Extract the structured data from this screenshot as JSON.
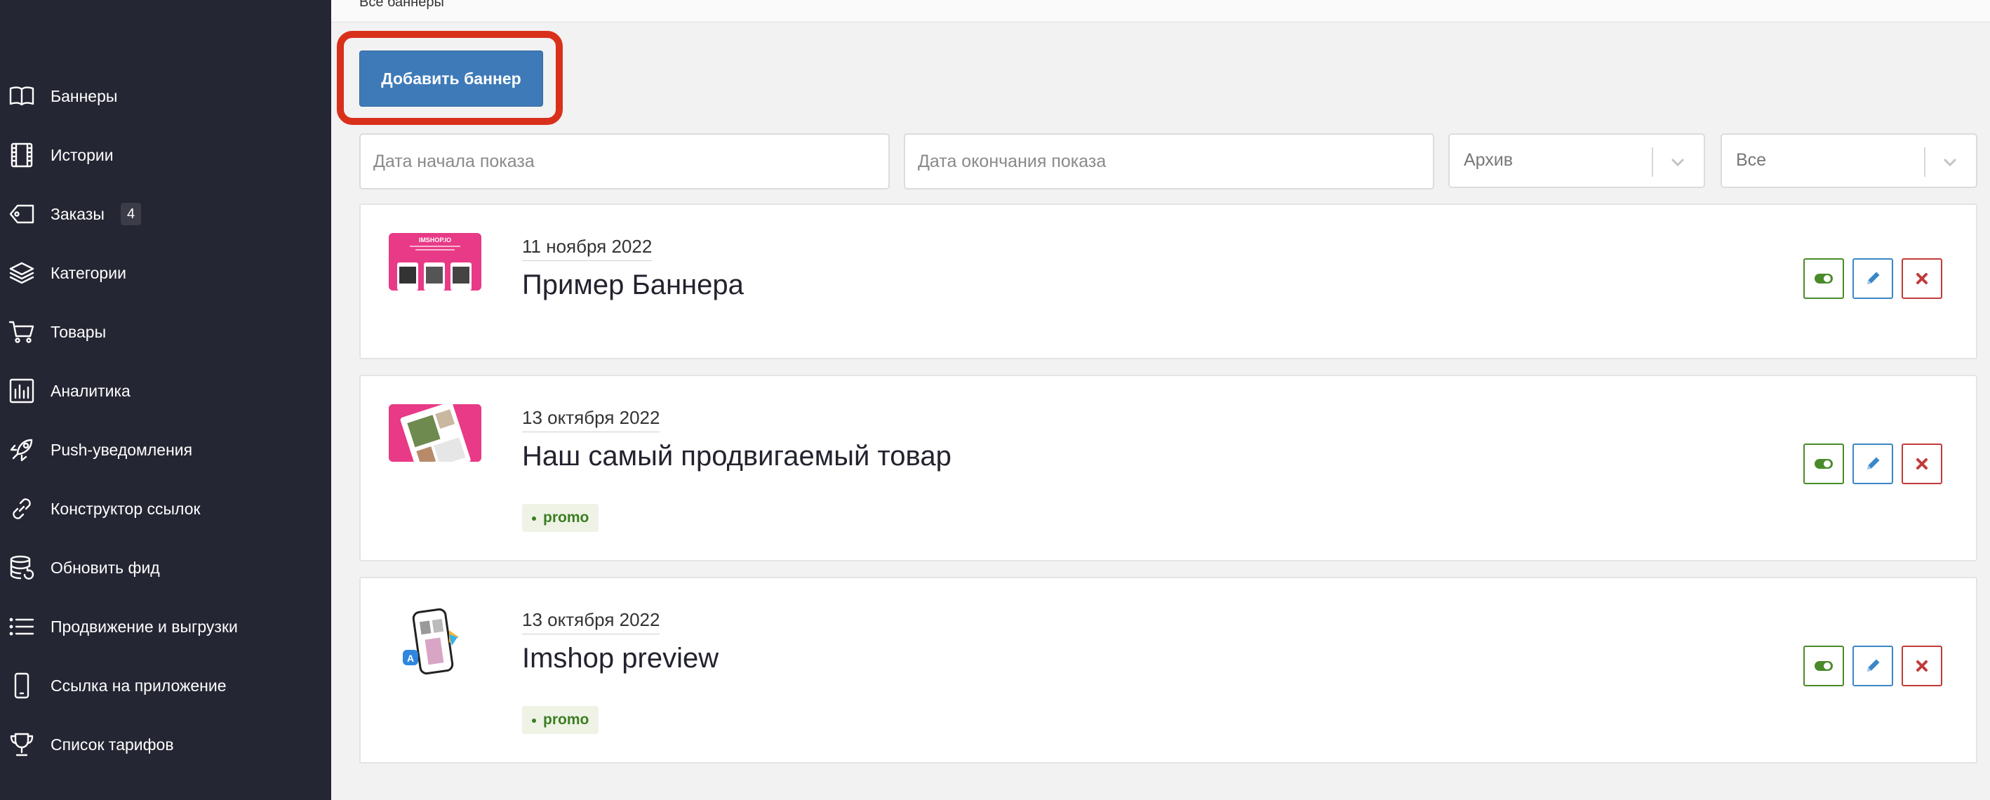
{
  "breadcrumb": "Все баннеры",
  "sidebar": {
    "items": [
      {
        "label": "Баннеры",
        "icon": "book-icon"
      },
      {
        "label": "Истории",
        "icon": "film-icon"
      },
      {
        "label": "Заказы",
        "icon": "tag-icon",
        "badge": "4"
      },
      {
        "label": "Категории",
        "icon": "layers-icon"
      },
      {
        "label": "Товары",
        "icon": "cart-icon"
      },
      {
        "label": "Аналитика",
        "icon": "chart-icon"
      },
      {
        "label": "Push-уведомления",
        "icon": "rocket-icon"
      },
      {
        "label": "Конструктор ссылок",
        "icon": "link-icon"
      },
      {
        "label": "Обновить фид",
        "icon": "database-icon"
      },
      {
        "label": "Продвижение и выгрузки",
        "icon": "list-icon"
      },
      {
        "label": "Ссылка на приложение",
        "icon": "phone-icon"
      },
      {
        "label": "Список тарифов",
        "icon": "trophy-icon"
      }
    ]
  },
  "toolbar": {
    "add_label": "Добавить баннер"
  },
  "filters": {
    "start_placeholder": "Дата начала показа",
    "end_placeholder": "Дата окончания показа",
    "archive_value": "Архив",
    "type_value": "Все"
  },
  "banners": [
    {
      "date": "11 ноября 2022",
      "title": "Пример Баннера",
      "tag": "",
      "thumb_label": "IMSHOP.IO"
    },
    {
      "date": "13 октября 2022",
      "title": "Наш самый продвигаемый товар",
      "tag": "promo"
    },
    {
      "date": "13 октября 2022",
      "title": "Imshop preview",
      "tag": "promo"
    }
  ],
  "colors": {
    "sidebar_bg": "#252633",
    "accent": "#3e7ab8",
    "highlight": "#d9301c",
    "toggle": "#4a8a2a",
    "edit": "#3a87c8",
    "delete": "#c23a3a"
  }
}
